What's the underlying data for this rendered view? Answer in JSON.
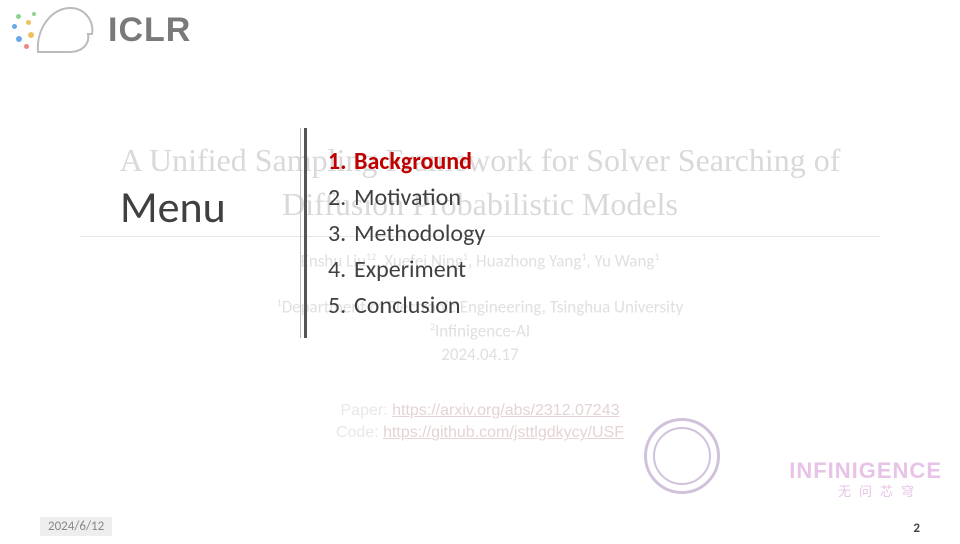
{
  "header": {
    "conference": "ICLR"
  },
  "background_slide": {
    "title_line1": "A Unified Sampling Framework for Solver Searching of",
    "title_line2": "Diffusion Probabilistic Models",
    "authors_html": "Enshu Liu¹², Xuefei Ning¹, Huazhong Yang¹, Yu Wang¹",
    "affil1": "¹Department of Electronic Engineering, Tsinghua University",
    "affil2": "²Infinigence-AI",
    "date": "2024.04.17",
    "paper_label": "Paper: ",
    "paper_url": "https://arxiv.org/abs/2312.07243",
    "code_label": "Code: ",
    "code_url": "https://github.com/jsttlgdkycy/USF"
  },
  "menu": {
    "label": "Menu",
    "items": [
      {
        "num": "1.",
        "label": "Background",
        "active": true
      },
      {
        "num": "2.",
        "label": "Motivation",
        "active": false
      },
      {
        "num": "3.",
        "label": "Methodology",
        "active": false
      },
      {
        "num": "4.",
        "label": "Experiment",
        "active": false
      },
      {
        "num": "5.",
        "label": "Conclusion",
        "active": false
      }
    ]
  },
  "logos": {
    "infinigence": "INFINIGENCE",
    "infinigence_sub": "无问芯穹"
  },
  "footer": {
    "date": "2024/6/12",
    "page": "2"
  }
}
